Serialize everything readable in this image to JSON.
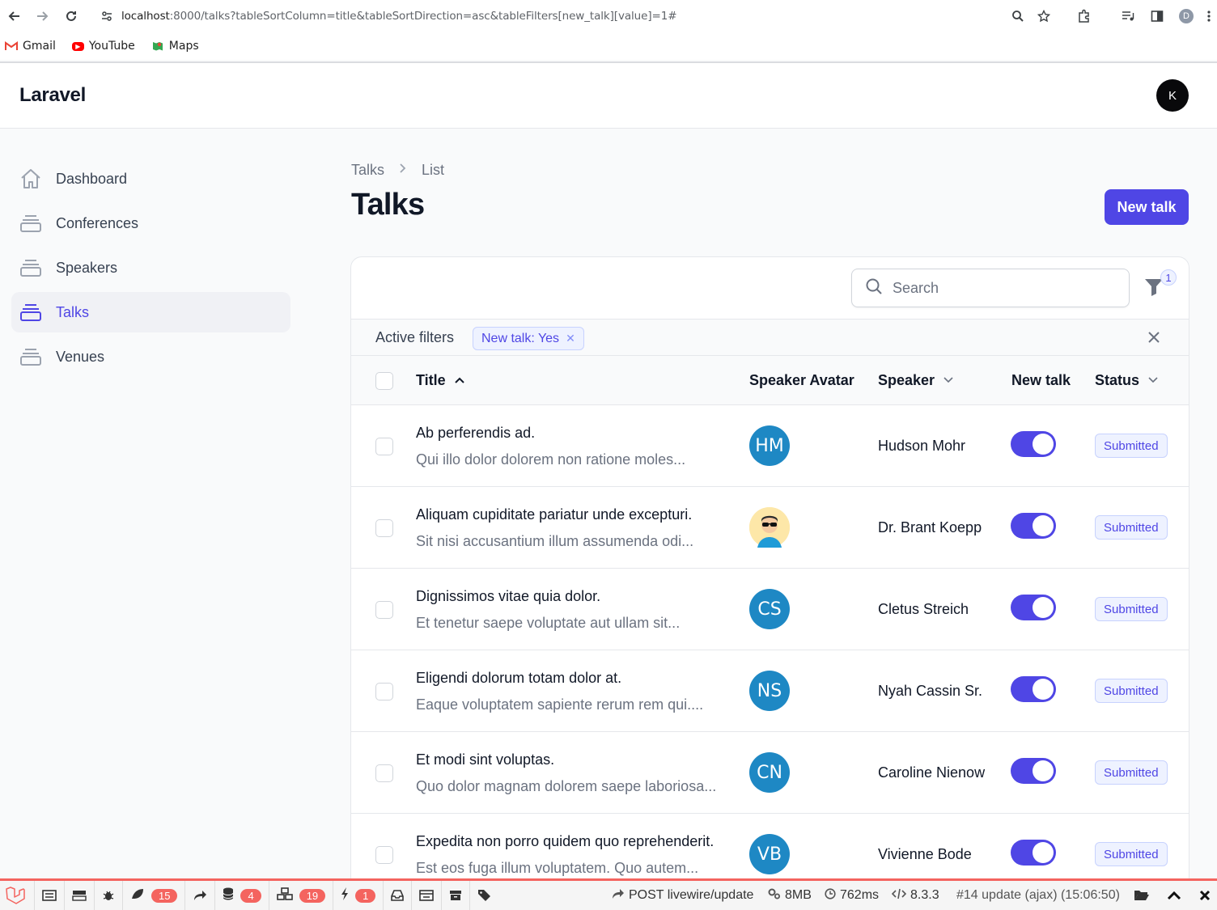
{
  "browser": {
    "url_host": "localhost",
    "url_rest": ":8000/talks?tableSortColumn=title&tableSortDirection=asc&tableFilters[new_talk][value]=1#",
    "profile_initial": "D",
    "bookmarks": [
      {
        "label": "Gmail",
        "icon": "gmail-icon"
      },
      {
        "label": "YouTube",
        "icon": "youtube-icon"
      },
      {
        "label": "Maps",
        "icon": "maps-icon"
      }
    ]
  },
  "app": {
    "brand": "Laravel",
    "user_initial": "K",
    "accent_color": "#4f46e5"
  },
  "sidebar": {
    "items": [
      {
        "label": "Dashboard",
        "icon": "home-icon",
        "active": false
      },
      {
        "label": "Conferences",
        "icon": "rectangle-stack-icon",
        "active": false
      },
      {
        "label": "Speakers",
        "icon": "rectangle-stack-icon",
        "active": false
      },
      {
        "label": "Talks",
        "icon": "rectangle-stack-icon",
        "active": true
      },
      {
        "label": "Venues",
        "icon": "rectangle-stack-icon",
        "active": false
      }
    ]
  },
  "main": {
    "breadcrumb": [
      "Talks",
      "List"
    ],
    "title": "Talks",
    "new_button": "New talk",
    "search_placeholder": "Search",
    "filter_count": "1",
    "active_filters_label": "Active filters",
    "active_filter_chip": "New talk: Yes",
    "columns": {
      "title": "Title",
      "avatar": "Speaker Avatar",
      "speaker": "Speaker",
      "new_talk": "New talk",
      "status": "Status"
    },
    "rows": [
      {
        "title": "Ab perferendis ad.",
        "desc": "Qui illo dolor dolorem non ratione moles...",
        "initials": "HM",
        "speaker": "Hudson Mohr",
        "new_talk": true,
        "status": "Submitted"
      },
      {
        "title": "Aliquam cupiditate pariatur unde excepturi.",
        "desc": "Sit nisi accusantium illum assumenda odi...",
        "initials": "",
        "speaker": "Dr. Brant Koepp",
        "new_talk": true,
        "status": "Submitted"
      },
      {
        "title": "Dignissimos vitae quia dolor.",
        "desc": "Et tenetur saepe voluptate aut ullam sit...",
        "initials": "CS",
        "speaker": "Cletus Streich",
        "new_talk": true,
        "status": "Submitted"
      },
      {
        "title": "Eligendi dolorum totam dolor at.",
        "desc": "Eaque voluptatem sapiente rerum rem qui....",
        "initials": "NS",
        "speaker": "Nyah Cassin Sr.",
        "new_talk": true,
        "status": "Submitted"
      },
      {
        "title": "Et modi sint voluptas.",
        "desc": "Quo dolor magnam dolorem saepe laboriosa...",
        "initials": "CN",
        "speaker": "Caroline Nienow",
        "new_talk": true,
        "status": "Submitted"
      },
      {
        "title": "Expedita non porro quidem quo reprehenderit.",
        "desc": "Est eos fuga illum voluptatem. Quo autem...",
        "initials": "VB",
        "speaker": "Vivienne Bode",
        "new_talk": true,
        "status": "Submitted"
      }
    ]
  },
  "debugbar": {
    "views_count": "15",
    "queries_count": "4",
    "models_count": "19",
    "events_count": "1",
    "request": "POST livewire/update",
    "memory": "8MB",
    "time": "762ms",
    "php_version": "8.3.3",
    "request_info": "#14 update (ajax) (15:06:50)"
  }
}
